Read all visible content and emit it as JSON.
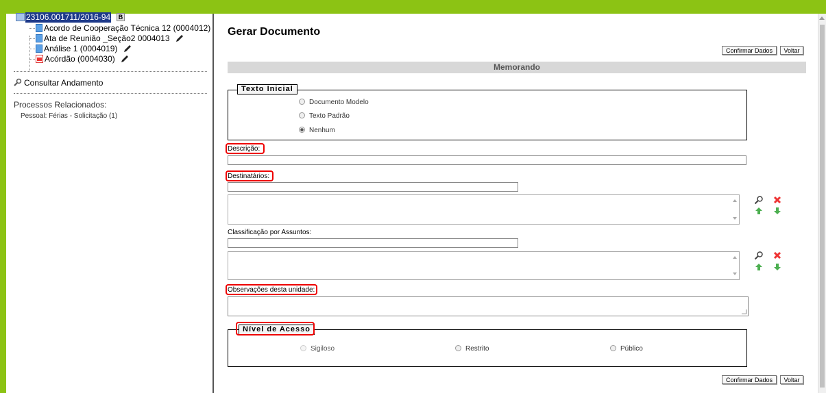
{
  "sidebar": {
    "process_number": "23106.001711/2016-94",
    "badge": "B",
    "documents": [
      {
        "label": "Acordo de Cooperação Técnica 12 (0004012)",
        "icon": "document-icon",
        "pen": false
      },
      {
        "label": "Ata de Reunião _Seção2 0004013",
        "icon": "document-icon",
        "pen": true
      },
      {
        "label": "Análise 1 (0004019)",
        "icon": "document-icon",
        "pen": true
      },
      {
        "label": "Acórdão (0004030)",
        "icon": "pdf-icon",
        "pen": true
      }
    ],
    "consultar": "Consultar Andamento",
    "related_title": "Processos Relacionados:",
    "related_items": [
      "Pessoal: Férias - Solicitação (1)"
    ]
  },
  "main": {
    "title": "Gerar Documento",
    "confirm_button": "Confirmar Dados",
    "back_button": "Voltar",
    "doc_type": "Memorando",
    "texto_inicial": {
      "legend": "Texto Inicial",
      "options": [
        "Documento Modelo",
        "Texto Padrão",
        "Nenhum"
      ],
      "selected": "Nenhum"
    },
    "descricao_label": "Descrição:",
    "descricao_value": "",
    "destinatarios_label": "Destinatários:",
    "classificacao_label": "Classificação por Assuntos:",
    "observacoes_label": "Observações desta unidade:",
    "nivel_acesso": {
      "legend": "Nível de Acesso",
      "options": [
        "Sigiloso",
        "Restrito",
        "Público"
      ]
    }
  },
  "colors": {
    "frame": "#8cc314",
    "highlight": "#e00000",
    "selection": "#1e3a8a"
  }
}
